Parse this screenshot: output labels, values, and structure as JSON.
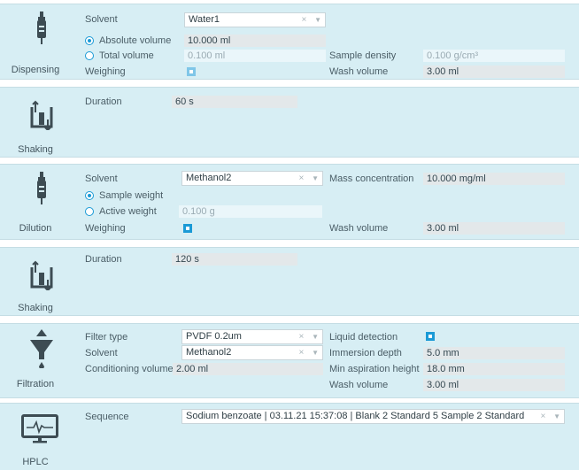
{
  "dispensing": {
    "label": "Dispensing",
    "solvent_label": "Solvent",
    "solvent_value": "Water1",
    "absolute_volume_label": "Absolute volume",
    "absolute_volume_value": "10.000 ml",
    "total_volume_label": "Total volume",
    "total_volume_value": "0.100 ml",
    "sample_density_label": "Sample density",
    "sample_density_value": "0.100 g/cm³",
    "weighing_label": "Weighing",
    "wash_volume_label": "Wash volume",
    "wash_volume_value": "3.00 ml"
  },
  "shaking1": {
    "label": "Shaking",
    "duration_label": "Duration",
    "duration_value": "60 s"
  },
  "dilution": {
    "label": "Dilution",
    "solvent_label": "Solvent",
    "solvent_value": "Methanol2",
    "mass_conc_label": "Mass concentration",
    "mass_conc_value": "10.000 mg/ml",
    "sample_weight_label": "Sample weight",
    "active_weight_label": "Active weight",
    "active_weight_value": "0.100 g",
    "weighing_label": "Weighing",
    "wash_volume_label": "Wash volume",
    "wash_volume_value": "3.00 ml"
  },
  "shaking2": {
    "label": "Shaking",
    "duration_label": "Duration",
    "duration_value": "120 s"
  },
  "filtration": {
    "label": "Filtration",
    "filter_type_label": "Filter type",
    "filter_type_value": "PVDF 0.2um",
    "liquid_detection_label": "Liquid detection",
    "solvent_label": "Solvent",
    "solvent_value": "Methanol2",
    "immersion_depth_label": "Immersion depth",
    "immersion_depth_value": "5.0 mm",
    "conditioning_volume_label": "Conditioning volume",
    "conditioning_volume_value": "2.00 ml",
    "min_aspiration_label": "Min aspiration height",
    "min_aspiration_value": "18.0 mm",
    "wash_volume_label": "Wash volume",
    "wash_volume_value": "3.00 ml"
  },
  "hplc": {
    "label": "HPLC",
    "sequence_label": "Sequence",
    "sequence_value": "Sodium benzoate | 03.11.21 15:37:08 | Blank 2 Standard 5 Sample 2 Standard"
  },
  "controls": {
    "clear": "×",
    "dropdown": "▼"
  },
  "colors": {
    "panel_bg": "#d7eef4",
    "accent": "#1a9ad6"
  }
}
